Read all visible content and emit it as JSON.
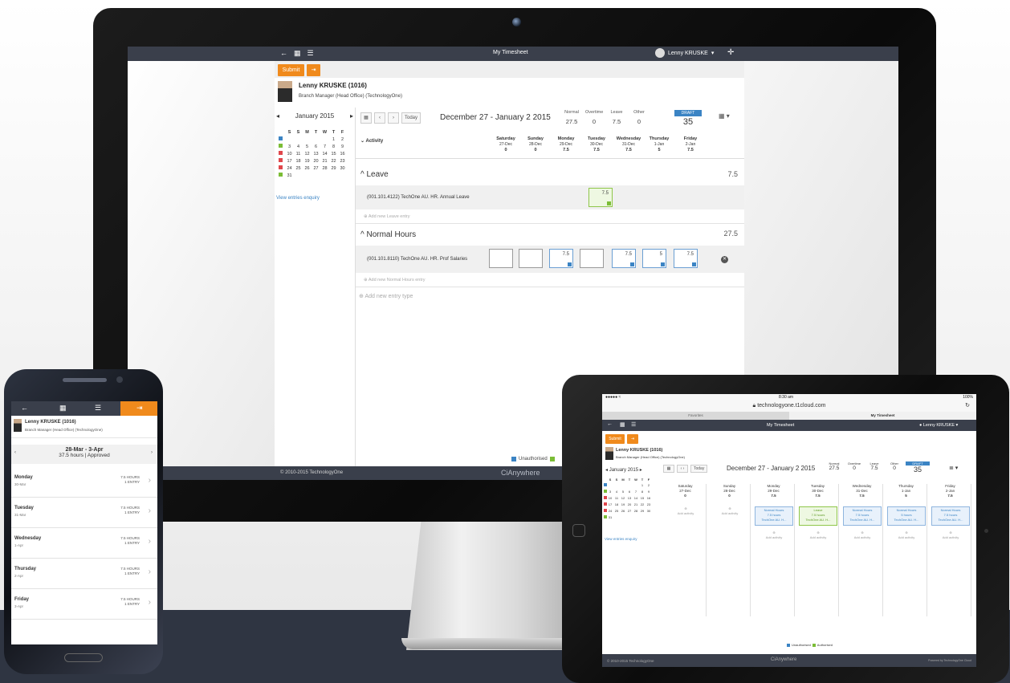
{
  "desktop": {
    "window_title": "My Timesheet",
    "user_name": "Lenny KRUSKE",
    "toolbar": {
      "submit_label": "Submit"
    },
    "person": {
      "name": "Lenny KRUSKE (1016)",
      "role": "Branch Manager (Head Office) (TechnologyOne)"
    },
    "calendar": {
      "month": "January 2015",
      "weekday_headers": [
        "S",
        "S",
        "M",
        "T",
        "W",
        "T",
        "F"
      ],
      "weeks": [
        {
          "marker": "#3b84c4",
          "days": [
            "",
            "",
            "",
            "",
            "",
            "1",
            "2"
          ]
        },
        {
          "marker": "#7bbd36",
          "days": [
            "3",
            "4",
            "5",
            "6",
            "7",
            "8",
            "9"
          ]
        },
        {
          "marker": "#e0474c",
          "days": [
            "10",
            "11",
            "12",
            "13",
            "14",
            "15",
            "16"
          ]
        },
        {
          "marker": "#e0474c",
          "days": [
            "17",
            "18",
            "19",
            "20",
            "21",
            "22",
            "23"
          ]
        },
        {
          "marker": "#e0474c",
          "days": [
            "24",
            "25",
            "26",
            "27",
            "28",
            "29",
            "30"
          ]
        },
        {
          "marker": "#7bbd36",
          "days": [
            "31",
            "",
            "",
            "",
            "",
            "",
            ""
          ]
        }
      ],
      "link": "View entries enquiry"
    },
    "timesheet": {
      "today": "Today",
      "range": "December 27 - January 2 2015",
      "totals": [
        {
          "label": "Normal",
          "value": "27.5"
        },
        {
          "label": "Overtime",
          "value": "0"
        },
        {
          "label": "Leave",
          "value": "7.5"
        },
        {
          "label": "Other",
          "value": "0"
        }
      ],
      "status": "DRAFT",
      "grand_total": "35",
      "activity_header": "Activity",
      "days": [
        {
          "name": "Saturday",
          "date": "27-Dec",
          "total": "0"
        },
        {
          "name": "Sunday",
          "date": "28-Dec",
          "total": "0"
        },
        {
          "name": "Monday",
          "date": "29-Dec",
          "total": "7.5"
        },
        {
          "name": "Tuesday",
          "date": "30-Dec",
          "total": "7.5"
        },
        {
          "name": "Wednesday",
          "date": "31-Dec",
          "total": "7.5"
        },
        {
          "name": "Thursday",
          "date": "1-Jan",
          "total": "5"
        },
        {
          "name": "Friday",
          "date": "2-Jan",
          "total": "7.5"
        }
      ],
      "leave": {
        "title": "Leave",
        "total": "7.5",
        "code": "(001.101.4122) TechOne AU. HR. Annual Leave",
        "cell_value": "7.5",
        "add": "Add new Leave entry"
      },
      "normal": {
        "title": "Normal Hours",
        "total": "27.5",
        "code": "(001.101.8110) TechOne AU. HR. Prof Salaries",
        "values": [
          "",
          "",
          "7.5",
          "",
          "7.5",
          "5",
          "7.5"
        ],
        "add": "Add new Normal Hours entry"
      },
      "add_type": "Add new entry type",
      "legend_unauthorised": "Unauthorised"
    },
    "footer": {
      "copyright": "© 2010-2015 TechnologyOne",
      "brand": "CiAnywhere"
    }
  },
  "phone": {
    "person": {
      "name": "Lenny KRUSKE (1016)",
      "role": "Branch Manager (Head Office) (TechnologyOne)"
    },
    "week": {
      "range": "28-Mar - 3-Apr",
      "summary": "37.5 hours | Approved"
    },
    "days": [
      {
        "name": "Monday",
        "date": "30-Mar",
        "hours": "7.5 HOURS",
        "entries": "1 ENTRY"
      },
      {
        "name": "Tuesday",
        "date": "31-Mar",
        "hours": "7.5 HOURS",
        "entries": "1 ENTRY"
      },
      {
        "name": "Wednesday",
        "date": "1-Apr",
        "hours": "7.5 HOURS",
        "entries": "1 ENTRY"
      },
      {
        "name": "Thursday",
        "date": "2-Apr",
        "hours": "7.5 HOURS",
        "entries": "1 ENTRY"
      },
      {
        "name": "Friday",
        "date": "3-Apr",
        "hours": "7.5 HOURS",
        "entries": "1 ENTRY"
      }
    ]
  },
  "tablet": {
    "status_time": "8:30 am",
    "status_battery": "100%",
    "url": "technologyone.t1cloud.com",
    "tabs": [
      "Favorites",
      "My Timesheet"
    ],
    "title": "My Timesheet",
    "user": "Lenny KRUSKE",
    "submit_label": "Submit",
    "person": {
      "name": "Lenny KRUSKE (1016)",
      "role": "Branch Manager (Head Office) (TechnologyOne)"
    },
    "month": "January 2015",
    "today": "Today",
    "range": "December 27 - January 2 2015",
    "totals": [
      {
        "label": "Normal",
        "value": "27.5"
      },
      {
        "label": "Overtime",
        "value": "0"
      },
      {
        "label": "Leave",
        "value": "7.5"
      },
      {
        "label": "Other",
        "value": "0"
      }
    ],
    "status": "DRAFT",
    "grand_total": "35",
    "days": [
      {
        "name": "Saturday",
        "date": "27-Dec",
        "total": "0",
        "card": "",
        "card_hours": "",
        "card_code": ""
      },
      {
        "name": "Sunday",
        "date": "28-Dec",
        "total": "0",
        "card": "",
        "card_hours": "",
        "card_code": ""
      },
      {
        "name": "Monday",
        "date": "29-Dec",
        "total": "7.5",
        "card": "Normal Hours",
        "card_hours": "7.5 hours",
        "card_code": "TechOne AU. H..."
      },
      {
        "name": "Tuesday",
        "date": "30-Dec",
        "total": "7.5",
        "card": "Leave",
        "card_hours": "7.5 hours",
        "card_code": "TechOne AU. H..."
      },
      {
        "name": "Wednesday",
        "date": "31-Dec",
        "total": "7.5",
        "card": "Normal Hours",
        "card_hours": "7.5 hours",
        "card_code": "TechOne AU. H..."
      },
      {
        "name": "Thursday",
        "date": "1-Jan",
        "total": "5",
        "card": "Normal Hours",
        "card_hours": "5 hours",
        "card_code": "TechOne AU. H..."
      },
      {
        "name": "Friday",
        "date": "2-Jan",
        "total": "7.5",
        "card": "Normal Hours",
        "card_hours": "7.5 hours",
        "card_code": "TechOne AU. H..."
      }
    ],
    "add_activity": "Add activity",
    "legend_unauthorised": "Unauthorised",
    "legend_authorised": "Authorised",
    "footer_copy": "© 2010-2015 TechnologyOne",
    "footer_brand": "CiAnywhere",
    "footer_powered": "Powered by TechnologyOne Cloud"
  },
  "colors": {
    "accent": "#f08a1c",
    "header": "#3a3f4b",
    "link": "#3b84c4",
    "approved": "#7bbd36",
    "rejected": "#e0474c"
  }
}
